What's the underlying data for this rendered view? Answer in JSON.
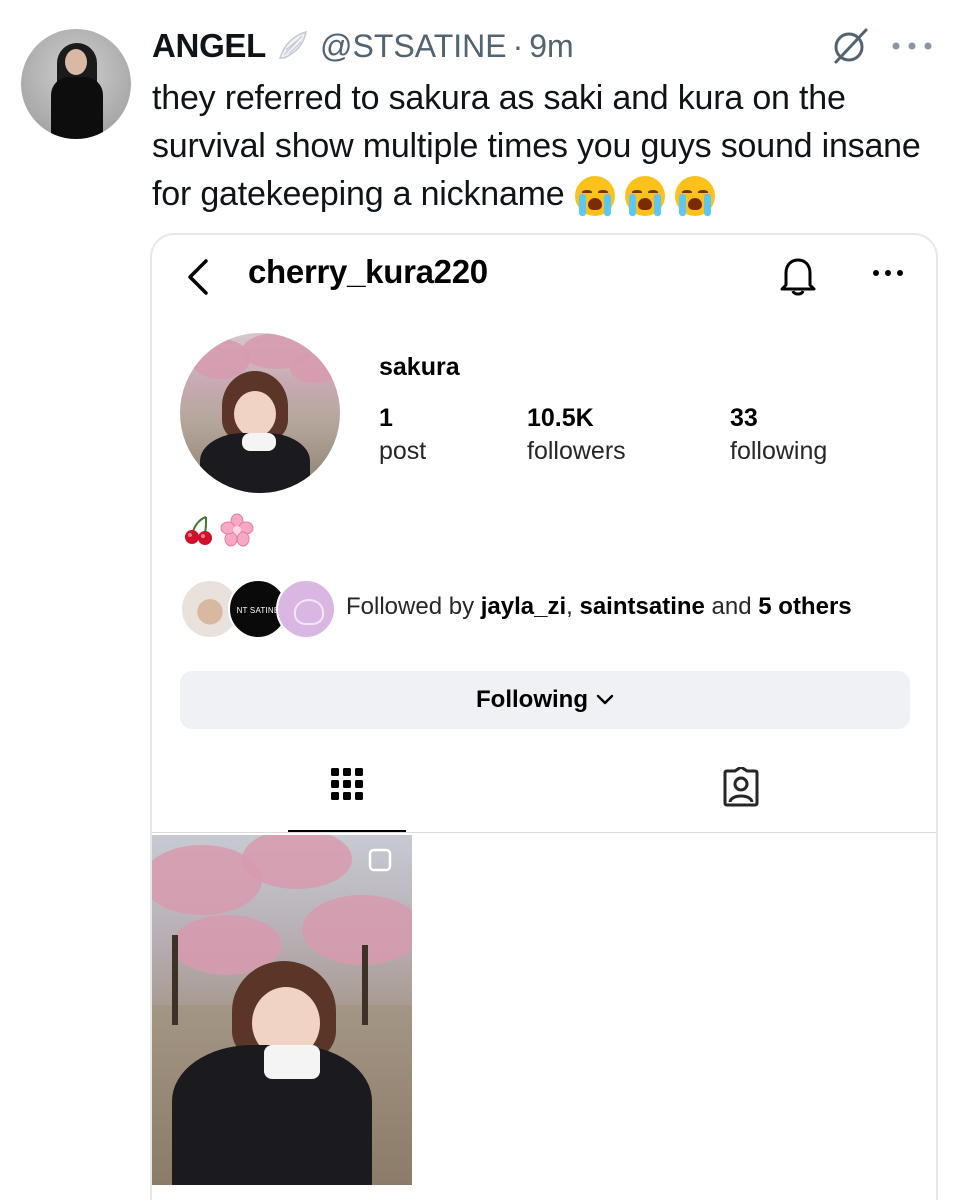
{
  "tweet": {
    "display_name": "ANGEL",
    "handle": "@STSATINE",
    "separator": "·",
    "time": "9m",
    "text": "they referred to sakura as saki and kura on the survival show multiple times you guys sound insane for gatekeeping a nickname",
    "emojis": [
      "😭",
      "😭",
      "😭"
    ],
    "icons": {
      "badge": "wing-icon",
      "grok": "grok-icon",
      "more": "more-horizontal-icon"
    }
  },
  "instagram": {
    "username": "cherry_kura220",
    "name": "sakura",
    "stats": [
      {
        "value": "1",
        "label": "post"
      },
      {
        "value": "10.5K",
        "label": "followers"
      },
      {
        "value": "33",
        "label": "following"
      }
    ],
    "bio": [
      "🍒",
      "🌸"
    ],
    "mutual_avatar_text": "NT SATINE",
    "followed_by": {
      "prefix": "Followed by ",
      "user1": "jayla_zi",
      "sep": ", ",
      "user2": "saintsatine",
      "and": " and ",
      "others": "5 others"
    },
    "following_button": "Following",
    "colors": {
      "button_bg": "#eff1f5",
      "divider": "#dbdbdb"
    }
  }
}
